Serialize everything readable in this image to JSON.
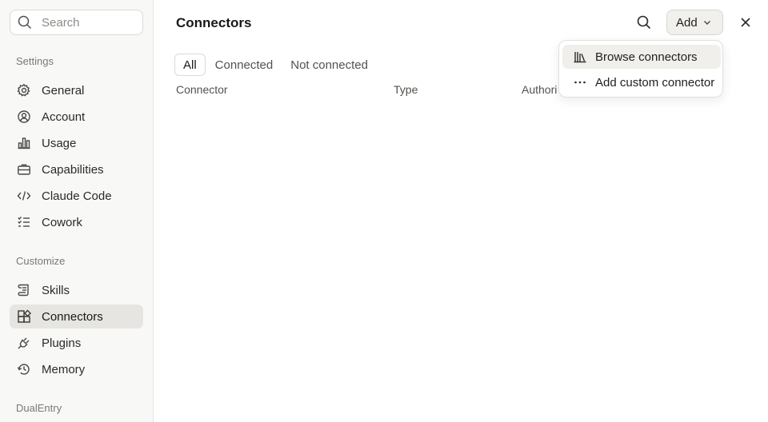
{
  "sidebar": {
    "search_placeholder": "Search",
    "sections": [
      {
        "label": "Settings"
      },
      {
        "label": "Customize"
      },
      {
        "label": "DualEntry"
      }
    ],
    "items": [
      {
        "label": "General",
        "icon": "gear-icon"
      },
      {
        "label": "Account",
        "icon": "user-circle-icon"
      },
      {
        "label": "Usage",
        "icon": "bar-chart-icon"
      },
      {
        "label": "Capabilities",
        "icon": "briefcase-icon"
      },
      {
        "label": "Claude Code",
        "icon": "code-icon"
      },
      {
        "label": "Cowork",
        "icon": "checklist-icon"
      },
      {
        "label": "Skills",
        "icon": "scroll-icon"
      },
      {
        "label": "Connectors",
        "icon": "connectors-icon",
        "active": true
      },
      {
        "label": "Plugins",
        "icon": "plug-icon"
      },
      {
        "label": "Memory",
        "icon": "history-icon"
      }
    ]
  },
  "main": {
    "title": "Connectors",
    "add_label": "Add",
    "tabs": [
      {
        "label": "All",
        "active": true
      },
      {
        "label": "Connected"
      },
      {
        "label": "Not connected"
      }
    ],
    "columns": [
      "Connector",
      "Type",
      "Authori"
    ]
  },
  "dropdown": {
    "items": [
      {
        "label": "Browse connectors",
        "icon": "library-icon"
      },
      {
        "label": "Add custom connector",
        "icon": "more-horizontal-icon"
      }
    ]
  },
  "colors": {
    "sidebar_bg": "#f8f8f7",
    "active_item_bg": "#e6e5e1",
    "text": "#1f1e1d",
    "muted_text": "#7b7974"
  }
}
